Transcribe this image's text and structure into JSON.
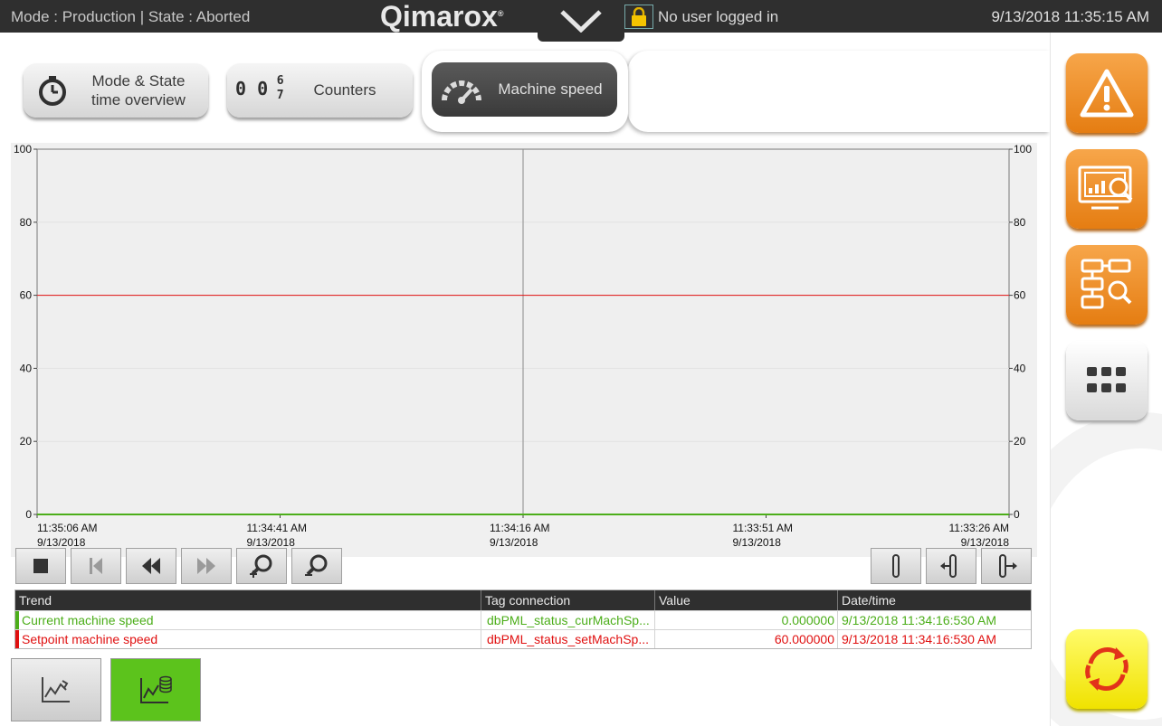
{
  "header": {
    "mode_state": "Mode : Production  |  State : Aborted",
    "logo": "Qimarox",
    "logo_reg": "®",
    "user_status": "No user logged in",
    "datetime": "9/13/2018 11:35:15 AM"
  },
  "tabs": [
    {
      "label_line1": "Mode & State",
      "label_line2": "time overview",
      "icon": "stopwatch-icon"
    },
    {
      "label": "Counters",
      "counter_digits": "0 0",
      "counter_rolling_top": "6",
      "counter_rolling_bottom": "7",
      "icon": "counter-icon"
    },
    {
      "label": "Machine speed",
      "icon": "speedometer-icon",
      "active": true
    }
  ],
  "side_buttons": [
    {
      "name": "alarm-button",
      "icon": "warning-icon",
      "color": "#ee8a22"
    },
    {
      "name": "report-button",
      "icon": "report-monitor-icon",
      "color": "#ee8a22"
    },
    {
      "name": "diagram-search-button",
      "icon": "flowchart-search-icon",
      "color": "#ee8a22"
    },
    {
      "name": "menu-button",
      "icon": "grid-dots-icon",
      "color": "#e6e6e6"
    },
    {
      "name": "refresh-button",
      "icon": "refresh-icon",
      "color": "#f4ea10"
    }
  ],
  "chart_data": {
    "type": "line",
    "x_ticks": [
      {
        "time": "11:35:06 AM",
        "date": "9/13/2018"
      },
      {
        "time": "11:34:41 AM",
        "date": "9/13/2018"
      },
      {
        "time": "11:34:16 AM",
        "date": "9/13/2018"
      },
      {
        "time": "11:33:51 AM",
        "date": "9/13/2018"
      },
      {
        "time": "11:33:26 AM",
        "date": "9/13/2018"
      }
    ],
    "y_ticks": [
      0,
      20,
      40,
      60,
      80,
      100
    ],
    "ylim": [
      0,
      100
    ],
    "grid": true,
    "cursor_x": "11:34:16 AM",
    "series": [
      {
        "name": "Current machine speed",
        "color": "#4cae1a",
        "values": [
          0,
          0
        ]
      },
      {
        "name": "Setpoint machine speed",
        "color": "#e01010",
        "values": [
          60,
          60
        ]
      }
    ]
  },
  "controls": [
    {
      "name": "stop-button",
      "icon": "stop-icon",
      "enabled": true
    },
    {
      "name": "first-button",
      "icon": "skip-start-icon",
      "enabled": false
    },
    {
      "name": "rewind-button",
      "icon": "rewind-icon",
      "enabled": true
    },
    {
      "name": "forward-button",
      "icon": "fast-forward-icon",
      "enabled": false
    },
    {
      "name": "zoom-in-button",
      "icon": "zoom-in-icon",
      "enabled": true
    },
    {
      "name": "zoom-out-button",
      "icon": "zoom-out-icon",
      "enabled": true
    },
    {
      "name": "ruler-button",
      "icon": "ruler-icon",
      "enabled": true
    },
    {
      "name": "ruler-left-button",
      "icon": "ruler-left-icon",
      "enabled": true
    },
    {
      "name": "ruler-right-button",
      "icon": "ruler-right-icon",
      "enabled": true
    }
  ],
  "table": {
    "headers": [
      "Trend",
      "Tag connection",
      "Value",
      "Date/time"
    ],
    "rows": [
      {
        "trend": "Current machine speed",
        "tag": "dbPML_status_curMachSp...",
        "value": "0.000000",
        "datetime": "9/13/2018 11:34:16:530 AM",
        "color": "#4cae1a"
      },
      {
        "trend": "Setpoint machine speed",
        "tag": "dbPML_status_setMachSp...",
        "value": "60.000000",
        "datetime": "9/13/2018 11:34:16:530 AM",
        "color": "#e01010"
      }
    ]
  },
  "bottom_buttons": [
    {
      "name": "trend-view-button",
      "icon": "trend-chart-icon",
      "active": false
    },
    {
      "name": "trend-data-button",
      "icon": "trend-database-icon",
      "active": true,
      "color": "#5cc31c"
    }
  ]
}
